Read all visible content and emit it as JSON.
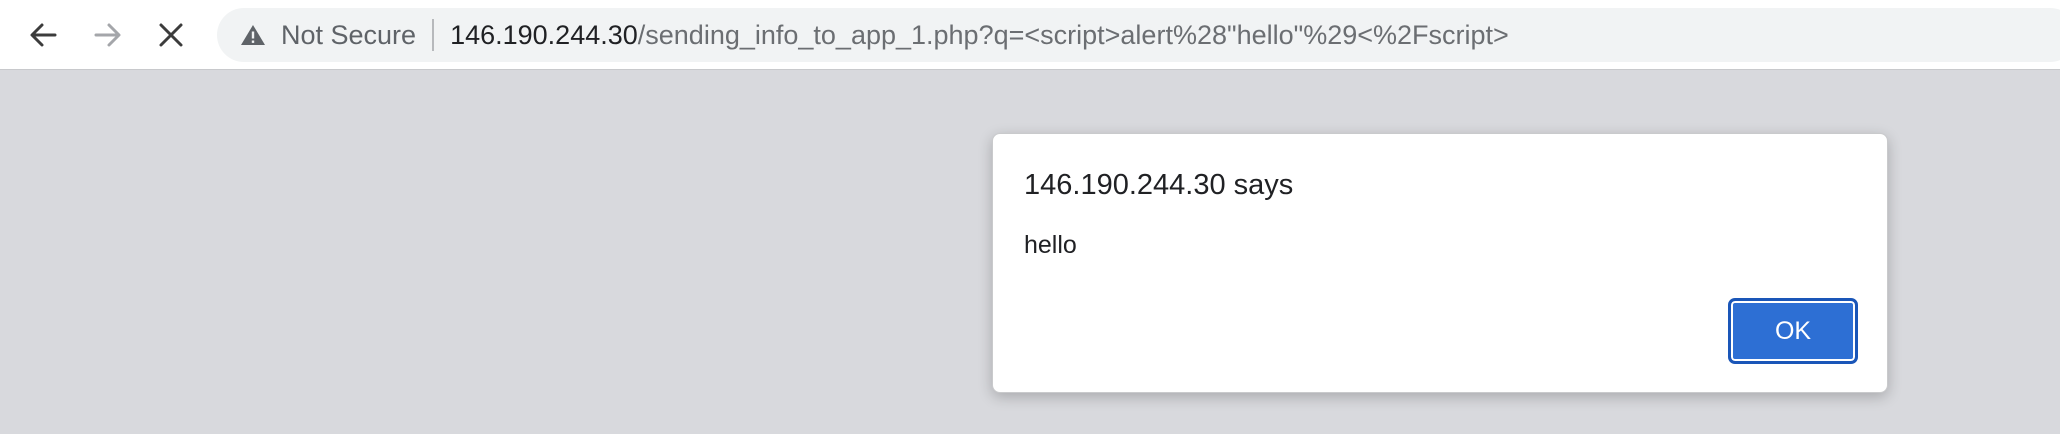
{
  "browser": {
    "nav": {
      "back_icon": "arrow-left-icon",
      "forward_icon": "arrow-right-icon",
      "stop_icon": "close-icon"
    },
    "omnibox": {
      "security_icon": "warning-triangle-icon",
      "security_label": "Not Secure",
      "url_host": "146.190.244.30",
      "url_path": "/sending_info_to_app_1.php?q=<script>alert%28\"hello\"%29<%2Fscript>"
    }
  },
  "alert_dialog": {
    "title": "146.190.244.30 says",
    "message": "hello",
    "ok_label": "OK"
  },
  "colors": {
    "page_background": "#d8d9dd",
    "ok_button": "#2d6fd4",
    "omnibox_background": "#f1f3f4"
  }
}
